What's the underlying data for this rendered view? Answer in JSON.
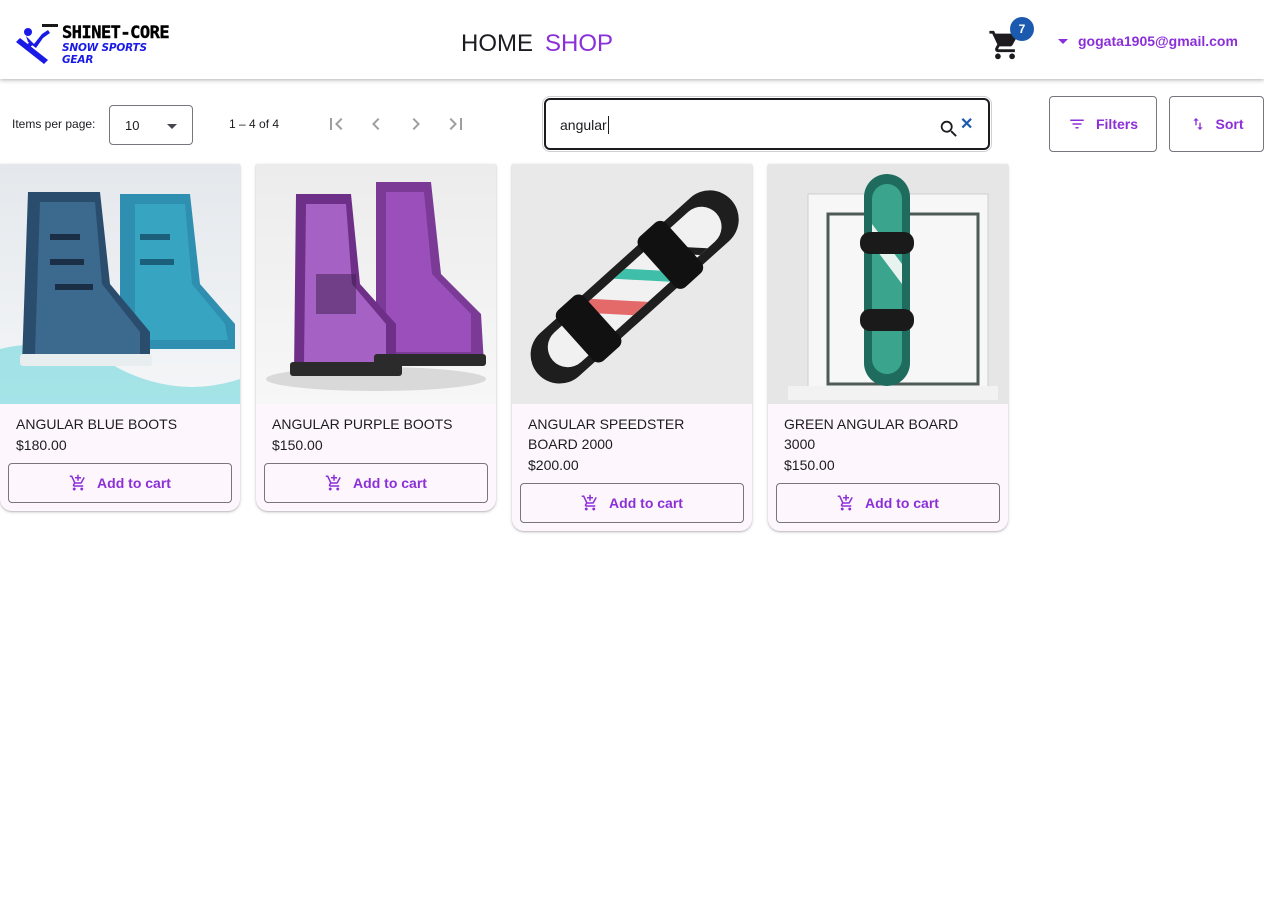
{
  "header": {
    "logo_line1": "SHINET-CORE",
    "logo_line2": "SNOW SPORTS GEAR",
    "nav": {
      "home": "HOME",
      "shop": "SHOP"
    },
    "cart_count": "7",
    "user_email": "gogata1905@gmail.com"
  },
  "toolbar": {
    "items_per_page_label": "Items per page:",
    "items_per_page_value": "10",
    "range_label": "1 – 4 of 4",
    "search_value": "angular",
    "filters_label": "Filters",
    "sort_label": "Sort"
  },
  "products": [
    {
      "name": "ANGULAR BLUE BOOTS",
      "price": "$180.00",
      "add_label": "Add to cart"
    },
    {
      "name": "ANGULAR PURPLE BOOTS",
      "price": "$150.00",
      "add_label": "Add to cart"
    },
    {
      "name": "ANGULAR SPEEDSTER BOARD 2000",
      "price": "$200.00",
      "add_label": "Add to cart"
    },
    {
      "name": "GREEN ANGULAR BOARD 3000",
      "price": "$150.00",
      "add_label": "Add to cart"
    }
  ],
  "colors": {
    "accent": "#8b2fd8",
    "badge": "#1c5ab0",
    "card_bg": "#fdf7fd"
  }
}
